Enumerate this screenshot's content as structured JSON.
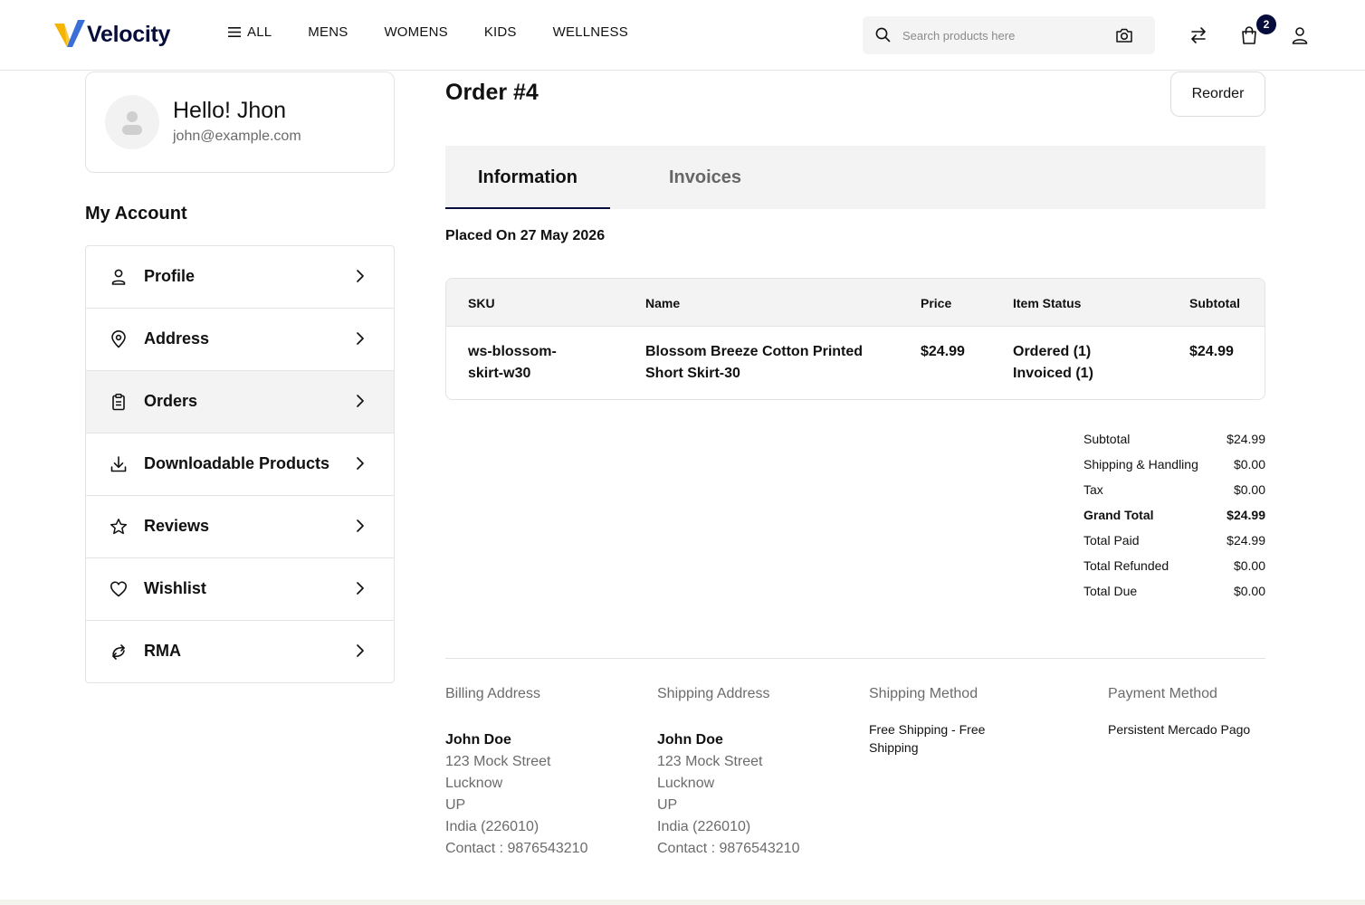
{
  "header": {
    "logo_text": "Velocity",
    "nav": [
      "ALL",
      "MENS",
      "WOMENS",
      "KIDS",
      "WELLNESS"
    ],
    "search_placeholder": "Search products here",
    "cart_count": "2"
  },
  "sidebar": {
    "greeting": "Hello! Jhon",
    "email": "john@example.com",
    "section_title": "My Account",
    "items": [
      {
        "label": "Profile",
        "icon": "user-icon"
      },
      {
        "label": "Address",
        "icon": "location-pin-icon"
      },
      {
        "label": "Orders",
        "icon": "clipboard-icon",
        "active": true
      },
      {
        "label": "Downloadable Products",
        "icon": "download-icon"
      },
      {
        "label": "Reviews",
        "icon": "star-icon"
      },
      {
        "label": "Wishlist",
        "icon": "heart-icon"
      },
      {
        "label": "RMA",
        "icon": "return-arrows-icon"
      }
    ]
  },
  "order": {
    "title": "Order #4",
    "reorder_label": "Reorder",
    "tabs": [
      "Information",
      "Invoices"
    ],
    "placed_on": "Placed On 27 May 2026",
    "table": {
      "headers": [
        "SKU",
        "Name",
        "Price",
        "Item Status",
        "Subtotal"
      ],
      "rows": [
        {
          "sku_line1": "ws-blossom-",
          "sku_line2": "skirt-w30",
          "name_line1": "Blossom Breeze Cotton Printed",
          "name_line2": "Short Skirt-30",
          "price": "$24.99",
          "status_line1": "Ordered (1)",
          "status_line2": "Invoiced (1)",
          "subtotal": "$24.99"
        }
      ]
    },
    "summary": [
      {
        "label": "Subtotal",
        "value": "$24.99"
      },
      {
        "label": "Shipping & Handling",
        "value": "$0.00"
      },
      {
        "label": "Tax",
        "value": "$0.00"
      },
      {
        "label": "Grand Total",
        "value": "$24.99",
        "bold": true
      },
      {
        "label": "Total Paid",
        "value": "$24.99"
      },
      {
        "label": "Total Refunded",
        "value": "$0.00"
      },
      {
        "label": "Total Due",
        "value": "$0.00"
      }
    ],
    "billing": {
      "heading": "Billing Address",
      "name": "John Doe",
      "street": "123 Mock Street",
      "city": "Lucknow",
      "state": "UP",
      "country": "India (226010)",
      "contact": "Contact : 9876543210"
    },
    "shipping": {
      "heading": "Shipping Address",
      "name": "John Doe",
      "street": "123 Mock Street",
      "city": "Lucknow",
      "state": "UP",
      "country": "India (226010)",
      "contact": "Contact : 9876543210"
    },
    "shipping_method": {
      "heading": "Shipping Method",
      "line1": "Free Shipping - Free",
      "line2": "Shipping"
    },
    "payment_method": {
      "heading": "Payment Method",
      "value": "Persistent Mercado Pago"
    }
  },
  "colors": {
    "brand_navy": "#060c3b",
    "logo_yellow": "#f5b400",
    "logo_blue": "#3a6fd8"
  }
}
